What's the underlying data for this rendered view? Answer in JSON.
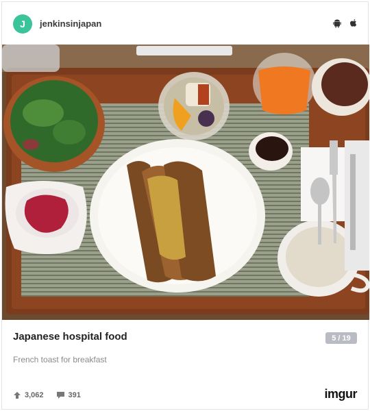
{
  "post": {
    "avatar_letter": "J",
    "username": "jenkinsinjapan",
    "platform_icons": [
      "android-icon",
      "apple-icon"
    ],
    "title": "Japanese hospital food",
    "pager": "5 / 19",
    "description": "French toast for breakfast",
    "upvotes": "3,062",
    "comments": "391",
    "brand": "imgur"
  },
  "colors": {
    "avatar": "#3bc39a",
    "pager_bg": "#b9bcc2",
    "brand_accent": "#1bb76e"
  }
}
